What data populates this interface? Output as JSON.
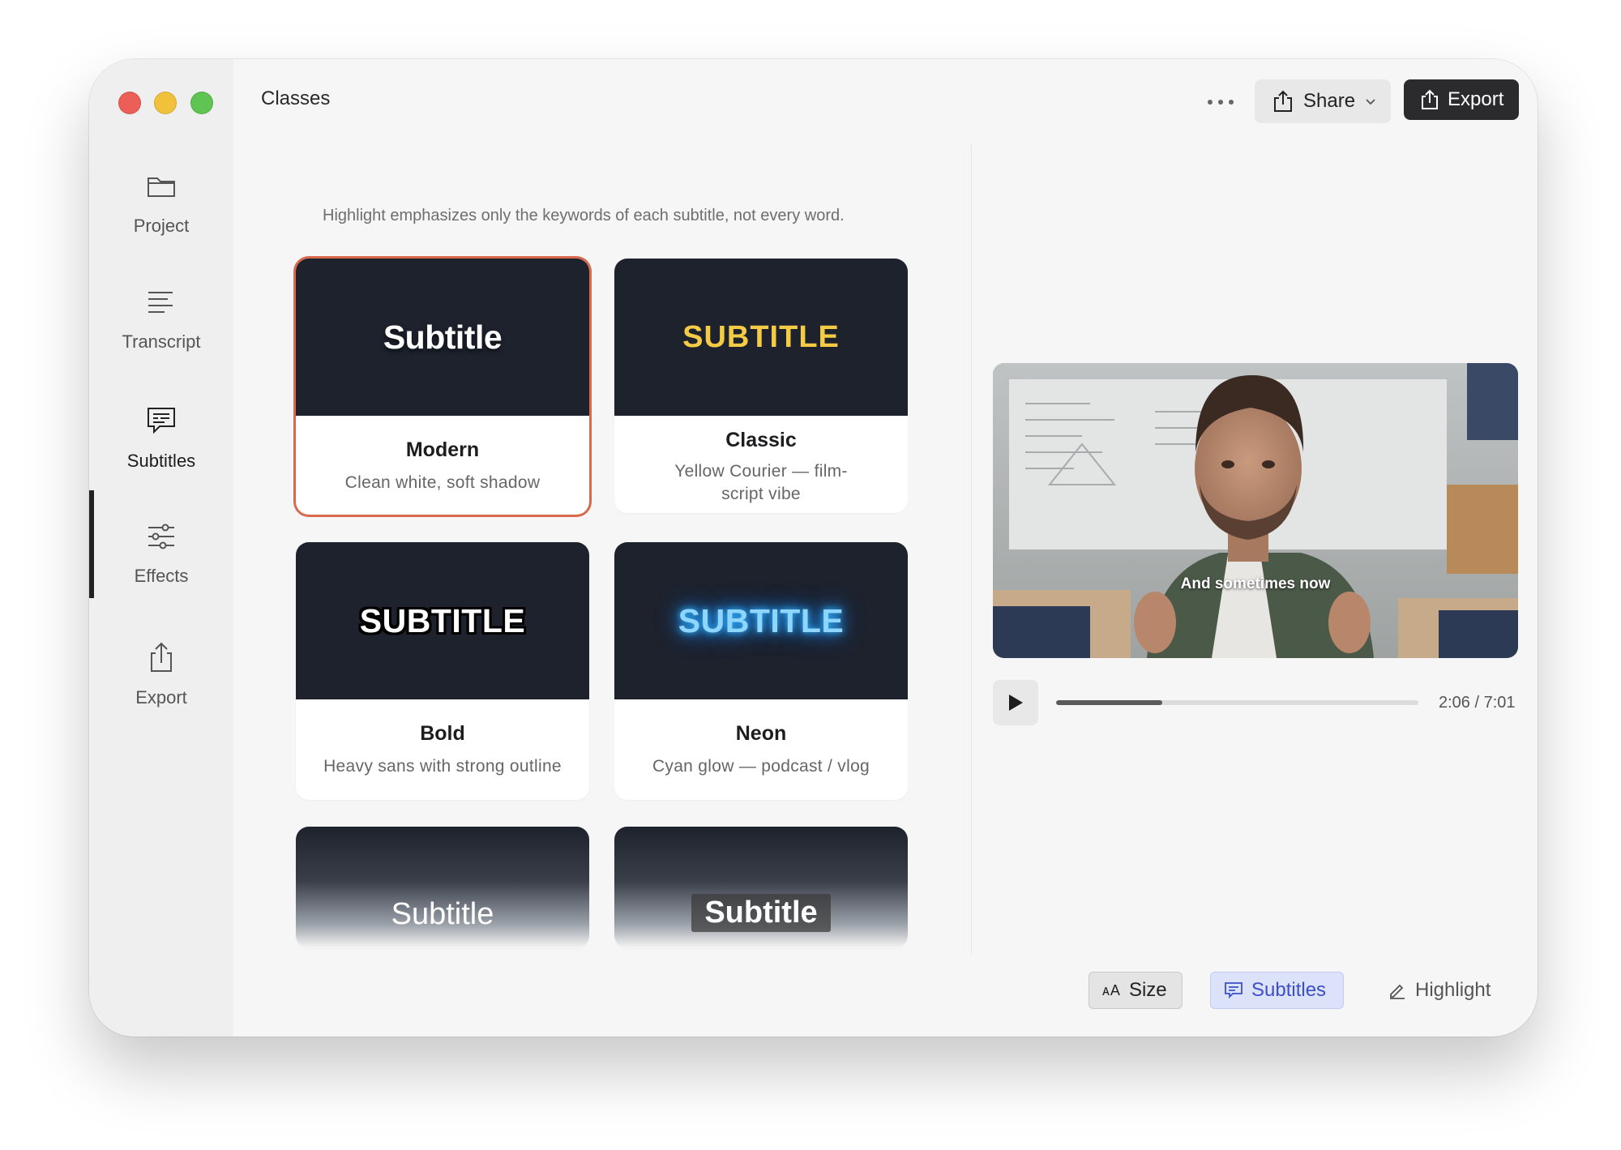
{
  "window": {
    "title": "Classes"
  },
  "sidebar": {
    "items": [
      {
        "id": "project",
        "label": "Project",
        "icon": "folder-icon"
      },
      {
        "id": "transcript",
        "label": "Transcript",
        "icon": "text-lines-icon"
      },
      {
        "id": "subtitles",
        "label": "Subtitles",
        "icon": "chat-bubble-icon",
        "active": true
      },
      {
        "id": "effects",
        "label": "Effects",
        "icon": "sliders-icon"
      },
      {
        "id": "export",
        "label": "Export",
        "icon": "share-icon"
      }
    ]
  },
  "toolbar": {
    "more_icon": "ellipsis-icon",
    "share_label": "Share",
    "export_label": "Export"
  },
  "styles": {
    "hint": "Highlight emphasizes only the keywords of each subtitle, not every word.",
    "cards": [
      {
        "preview": "Subtitle",
        "name": "Modern",
        "desc": "Clean white, soft shadow",
        "selected": true
      },
      {
        "preview": "SUBTITLE",
        "name": "Classic",
        "desc": "Yellow Courier — film-script vibe"
      },
      {
        "preview": "SUBTITLE",
        "name": "Bold",
        "desc": "Heavy sans with strong outline"
      },
      {
        "preview": "SUBTITLE",
        "name": "Neon",
        "desc": "Cyan glow — podcast / vlog"
      },
      {
        "preview": "Subtitle"
      },
      {
        "preview": "Subtitle"
      }
    ]
  },
  "player": {
    "caption": "And sometimes now",
    "progress": 0.293,
    "time": "2:06 / 7:01"
  },
  "bottom_bar": {
    "size_label": "Size",
    "subtitles_label": "Subtitles",
    "highlight_label": "Highlight"
  },
  "colors": {
    "selected_border": "#d9694c",
    "accent_blue": "#3b4fc7",
    "classic_yellow": "#f4cb45",
    "neon_cyan": "#8fd6ff"
  }
}
